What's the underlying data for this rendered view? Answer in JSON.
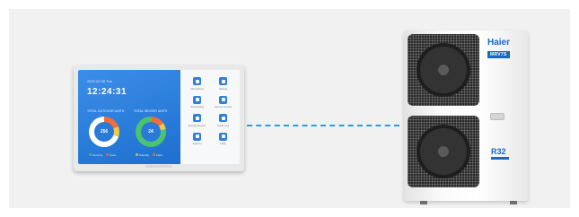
{
  "controller": {
    "screen": {
      "date": "2022.02.08  Tue",
      "time": "12:24:31",
      "gauges": [
        {
          "label": "TOTAL OUTDOOR UNITS",
          "value": "256"
        },
        {
          "label": "TOTAL INDOOR UNITS",
          "value": "24"
        }
      ],
      "legend": [
        "Running",
        "Standby",
        "Fault"
      ],
      "apps": [
        {
          "label": "Monitoring",
          "icon": "monitor-icon"
        },
        {
          "label": "Setting",
          "icon": "gear-icon"
        },
        {
          "label": "Scheduling",
          "icon": "calendar-icon"
        },
        {
          "label": "Group Control",
          "icon": "group-icon"
        },
        {
          "label": "Energy Report",
          "icon": "chart-icon"
        },
        {
          "label": "Fault Log",
          "icon": "alert-icon"
        },
        {
          "label": "System",
          "icon": "system-icon"
        },
        {
          "label": "Help",
          "icon": "help-icon"
        }
      ]
    }
  },
  "outdoor_unit": {
    "brand": "Haier",
    "model": "MRV7S",
    "refrigerant": "R32"
  },
  "colors": {
    "brand_blue": "#1769c4",
    "connection": "#2a9fd6",
    "screen_blue": "#2a7bd9"
  }
}
